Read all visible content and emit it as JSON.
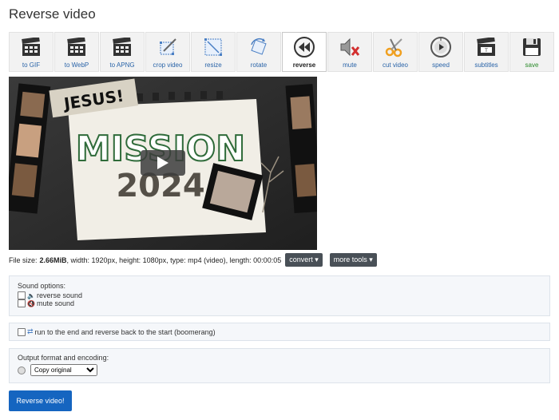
{
  "page_title": "Reverse video",
  "tools": [
    {
      "label": "to GIF",
      "icon": "clapperboard-icon"
    },
    {
      "label": "to WebP",
      "icon": "clapperboard-icon"
    },
    {
      "label": "to APNG",
      "icon": "clapperboard-icon"
    },
    {
      "label": "crop video",
      "icon": "crop-icon"
    },
    {
      "label": "resize",
      "icon": "resize-icon"
    },
    {
      "label": "rotate",
      "icon": "rotate-icon"
    },
    {
      "label": "reverse",
      "icon": "rewind-icon"
    },
    {
      "label": "mute",
      "icon": "mute-icon"
    },
    {
      "label": "cut video",
      "icon": "scissors-icon"
    },
    {
      "label": "speed",
      "icon": "speedometer-icon"
    },
    {
      "label": "subtitles",
      "icon": "subtitles-icon"
    },
    {
      "label": "save",
      "icon": "floppy-icon"
    }
  ],
  "video": {
    "badge_text": "JESUS!",
    "headline": "MISSION",
    "year": "2024"
  },
  "file_info": {
    "prefix": "File size:",
    "size": "2.66MiB",
    "details": ", width: 1920px, height: 1080px, type: mp4 (video), length: 00:00:05",
    "convert_label": "convert ▾",
    "more_tools_label": "more tools ▾"
  },
  "sound_options": {
    "heading": "Sound options:",
    "reverse_label": "reverse sound",
    "mute_label": "mute sound"
  },
  "boomerang_label": "run to the end and reverse back to the start (boomerang)",
  "output": {
    "heading": "Output format and encoding:",
    "selected": "Copy original"
  },
  "submit_label": "Reverse video!"
}
